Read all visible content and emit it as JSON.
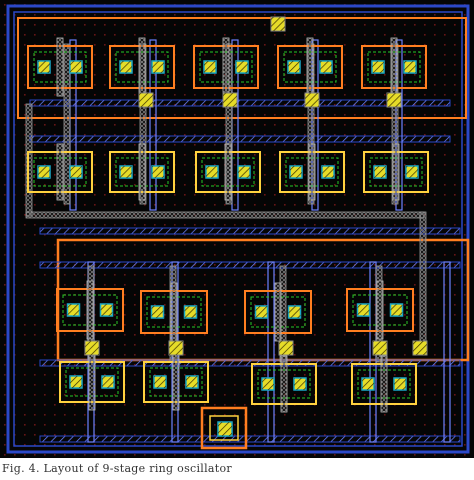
{
  "figure": {
    "caption": "Fig. 4.   Layout of 9-stage ring oscillator"
  },
  "colors": {
    "substrate": "#000000",
    "dots": "#6a1414",
    "metal1": "#2b48c8",
    "metal1_light": "#6d82ff",
    "poly": "#ffffff",
    "diffusion_pmos": "#ff7f20",
    "diffusion_nmos": "#ffd23f",
    "active": "#19a8c8",
    "contact": "#e6dc28",
    "via": "#2b2bd6",
    "select_outline": "#28c828",
    "pad_ring": "#ff7f20"
  },
  "icons": {
    "contact": "hatched-square-icon",
    "via": "crosshatch-cell-icon"
  }
}
